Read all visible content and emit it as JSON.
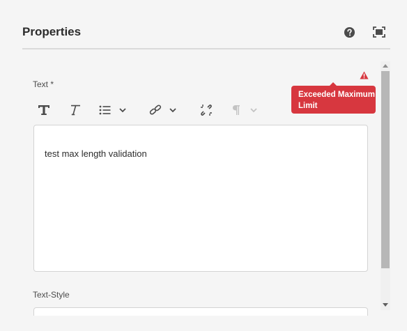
{
  "header": {
    "title": "Properties",
    "help_icon": "help-circle-icon",
    "fullscreen_icon": "fullscreen-icon"
  },
  "form": {
    "text_label": "Text *",
    "validation": {
      "icon": "alert-triangle-icon",
      "message": "Exceeded Maximum Limit",
      "color": "#d7373f"
    },
    "toolbar": {
      "bold_icon": "bold-icon",
      "italic_icon": "italic-icon",
      "list_icon": "bulleted-list-icon",
      "link_icon": "link-icon",
      "unlink_icon": "unlink-icon",
      "paragraph_icon": "paragraph-icon"
    },
    "editor_value": "test max length validation",
    "text_style_label": "Text-Style"
  },
  "colors": {
    "background": "#f5f5f5",
    "error": "#d7373f",
    "scrollbar_thumb": "#b7b7b7"
  }
}
